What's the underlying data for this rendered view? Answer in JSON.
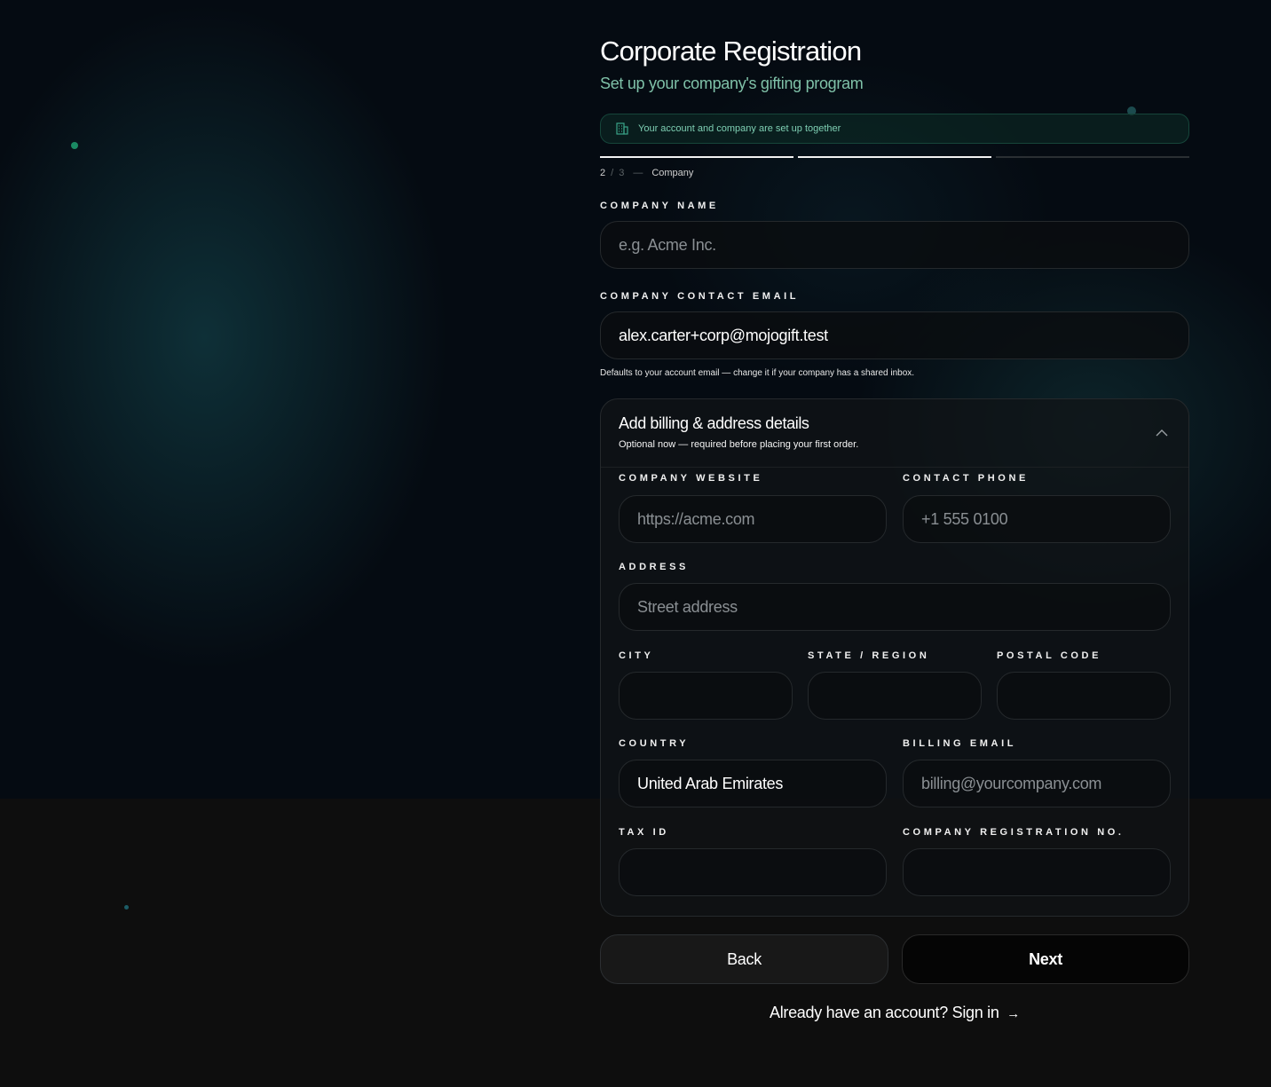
{
  "header": {
    "title": "Corporate Registration",
    "subtitle": "Set up your company's gifting program"
  },
  "banner": {
    "text": "Your account and company are set up together",
    "icon": "building-icon"
  },
  "steps": {
    "current": "2",
    "total": "3",
    "separator": "/",
    "dash": "—",
    "name": "Company",
    "completed_segments": 2,
    "total_segments": 3
  },
  "company_name": {
    "label": "Company Name",
    "placeholder": "e.g. Acme Inc.",
    "value": ""
  },
  "company_email": {
    "label": "Company Contact Email",
    "value": "alex.carter+corp@mojogift.test",
    "help": "Defaults to your account email — change it if your company has a shared inbox."
  },
  "billing": {
    "title": "Add billing & address details",
    "subtitle": "Optional now — required before placing your first order.",
    "expanded": true,
    "website": {
      "label": "Company Website",
      "placeholder": "https://acme.com"
    },
    "phone": {
      "label": "Contact Phone",
      "placeholder": "+1 555 0100"
    },
    "address": {
      "label": "Address",
      "placeholder": "Street address"
    },
    "city": {
      "label": "City",
      "value": ""
    },
    "state": {
      "label": "State / Region",
      "value": ""
    },
    "postal": {
      "label": "Postal Code",
      "value": ""
    },
    "country": {
      "label": "Country",
      "value": "United Arab Emirates"
    },
    "billing_email": {
      "label": "Billing Email",
      "placeholder": "billing@yourcompany.com"
    },
    "tax_id": {
      "label": "Tax ID",
      "value": ""
    },
    "registration_no": {
      "label": "Company Registration No.",
      "value": ""
    }
  },
  "actions": {
    "back": "Back",
    "next": "Next"
  },
  "footer": {
    "signin": "Already have an account? Sign in",
    "arrow": "→"
  },
  "colors": {
    "accent": "#7fc1a8",
    "banner_border": "#16453a",
    "background": "#050b12"
  }
}
